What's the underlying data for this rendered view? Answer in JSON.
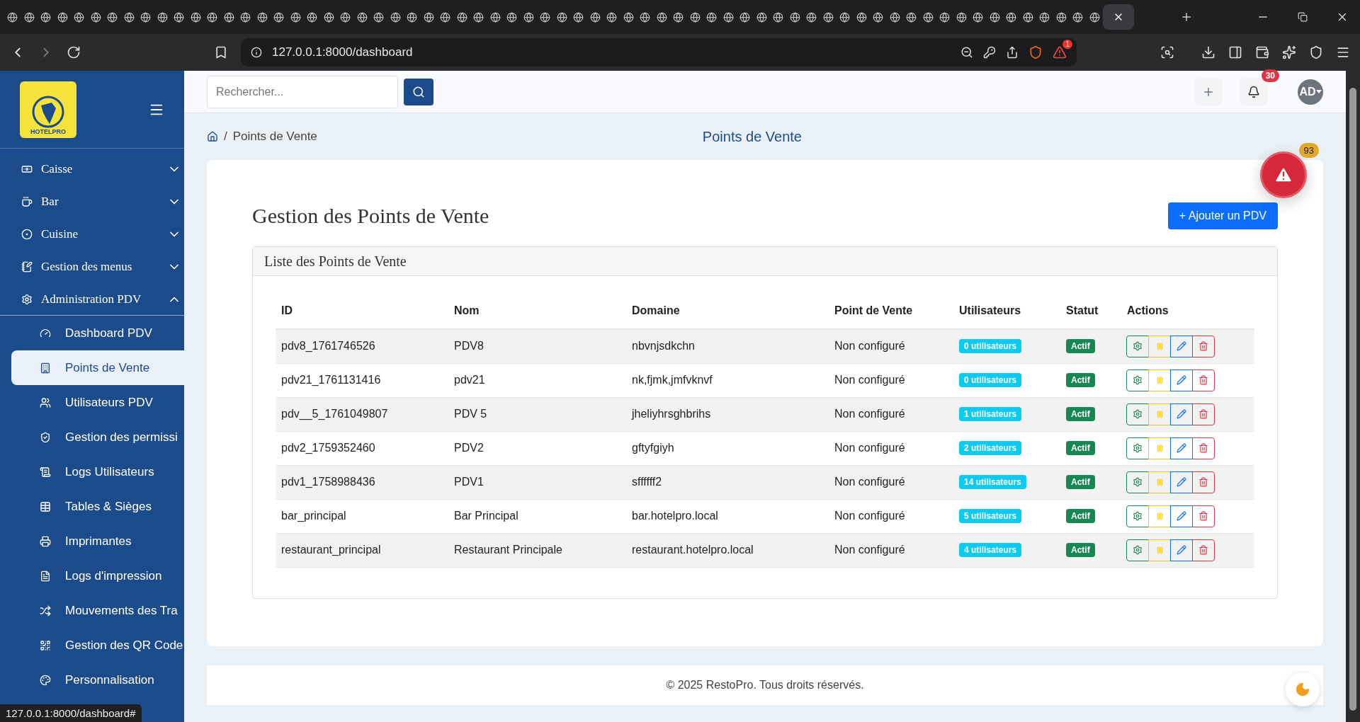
{
  "browser": {
    "tabs": [
      {
        "selected": false
      },
      {
        "selected": false
      },
      {
        "selected": false
      },
      {
        "selected": false
      },
      {
        "selected": false
      },
      {
        "selected": false
      },
      {
        "selected": false
      },
      {
        "selected": false
      },
      {
        "selected": false
      },
      {
        "selected": false
      },
      {
        "selected": false
      },
      {
        "selected": false
      },
      {
        "selected": false
      },
      {
        "selected": false
      },
      {
        "selected": false
      },
      {
        "selected": false
      },
      {
        "selected": false
      },
      {
        "selected": false
      },
      {
        "selected": false
      },
      {
        "selected": false
      },
      {
        "selected": false
      },
      {
        "selected": false
      },
      {
        "selected": false
      },
      {
        "selected": false
      },
      {
        "selected": false
      },
      {
        "selected": false
      },
      {
        "selected": false
      },
      {
        "selected": false
      },
      {
        "selected": false
      },
      {
        "selected": false
      },
      {
        "selected": false
      },
      {
        "selected": false
      },
      {
        "selected": false
      },
      {
        "selected": false
      },
      {
        "selected": false
      },
      {
        "selected": false
      },
      {
        "selected": false
      },
      {
        "selected": false
      },
      {
        "selected": false
      },
      {
        "selected": false
      },
      {
        "selected": false
      },
      {
        "selected": false
      },
      {
        "selected": false
      },
      {
        "selected": false
      },
      {
        "selected": false
      },
      {
        "selected": false
      },
      {
        "selected": false
      },
      {
        "selected": false
      },
      {
        "selected": false
      },
      {
        "selected": false
      },
      {
        "selected": false
      },
      {
        "selected": false
      },
      {
        "selected": false
      },
      {
        "selected": false
      },
      {
        "selected": false
      },
      {
        "selected": false
      },
      {
        "selected": false
      },
      {
        "selected": false
      },
      {
        "selected": false
      },
      {
        "selected": false
      },
      {
        "selected": false
      },
      {
        "selected": false
      },
      {
        "selected": false
      },
      {
        "selected": false
      },
      {
        "selected": false
      },
      {
        "selected": false
      },
      {
        "selected": true
      }
    ],
    "url": "127.0.0.1:8000/dashboard",
    "shield_badge": "1",
    "status_url": "127.0.0.1:8000/dashboard#"
  },
  "sidebar": {
    "brand": "HOTELPRO",
    "sections": [
      {
        "label": "Caisse",
        "expanded": false
      },
      {
        "label": "Bar",
        "expanded": false
      },
      {
        "label": "Cuisine",
        "expanded": false
      },
      {
        "label": "Gestion des menus",
        "expanded": false
      },
      {
        "label": "Administration PDV",
        "expanded": true,
        "children": [
          {
            "label": "Dashboard PDV",
            "selected": false
          },
          {
            "label": "Points de Vente",
            "selected": true
          },
          {
            "label": "Utilisateurs PDV",
            "selected": false
          },
          {
            "label": "Gestion des permissi",
            "selected": false
          },
          {
            "label": "Logs Utilisateurs",
            "selected": false
          },
          {
            "label": "Tables & Sièges",
            "selected": false
          },
          {
            "label": "Imprimantes",
            "selected": false
          },
          {
            "label": "Logs d'impression",
            "selected": false
          },
          {
            "label": "Mouvements des Tra",
            "selected": false
          },
          {
            "label": "Gestion des QR Code",
            "selected": false
          },
          {
            "label": "Personnalisation",
            "selected": false
          }
        ]
      }
    ]
  },
  "topbar": {
    "search": {
      "placeholder": "Rechercher..."
    },
    "notifications": "30",
    "avatar": "AD"
  },
  "breadcrumb": {
    "separator": "/",
    "current": "Points de Vente",
    "title": "Points de Vente"
  },
  "alert_badge": "93",
  "page": {
    "title": "Gestion des Points de Vente",
    "add_button": "+ Ajouter un PDV",
    "list_title": "Liste des Points de Vente",
    "columns": [
      "ID",
      "Nom",
      "Domaine",
      "Point de Vente",
      "Utilisateurs",
      "Statut",
      "Actions"
    ],
    "rows": [
      {
        "id": "pdv8_1761746526",
        "name": "PDV8",
        "domain": "nbvnjsdkchn",
        "pdv": "Non configuré",
        "users": "0 utilisateurs",
        "status": "Actif"
      },
      {
        "id": "pdv21_1761131416",
        "name": "pdv21",
        "domain": "nk,fjmk,jmfvknvf",
        "pdv": "Non configuré",
        "users": "0 utilisateurs",
        "status": "Actif"
      },
      {
        "id": "pdv__5_1761049807",
        "name": "PDV 5",
        "domain": "jheliyhrsghbrihs",
        "pdv": "Non configuré",
        "users": "1 utilisateurs",
        "status": "Actif"
      },
      {
        "id": "pdv2_1759352460",
        "name": "PDV2",
        "domain": "gftyfgiyh",
        "pdv": "Non configuré",
        "users": "2 utilisateurs",
        "status": "Actif"
      },
      {
        "id": "pdv1_1758988436",
        "name": "PDV1",
        "domain": "sffffff2",
        "pdv": "Non configuré",
        "users": "14 utilisateurs",
        "status": "Actif"
      },
      {
        "id": "bar_principal",
        "name": "Bar Principal",
        "domain": "bar.hotelpro.local",
        "pdv": "Non configuré",
        "users": "5 utilisateurs",
        "status": "Actif"
      },
      {
        "id": "restaurant_principal",
        "name": "Restaurant Principale",
        "domain": "restaurant.hotelpro.local",
        "pdv": "Non configuré",
        "users": "4 utilisateurs",
        "status": "Actif"
      }
    ]
  },
  "footer": "© 2025 RestoPro. Tous droits réservés."
}
